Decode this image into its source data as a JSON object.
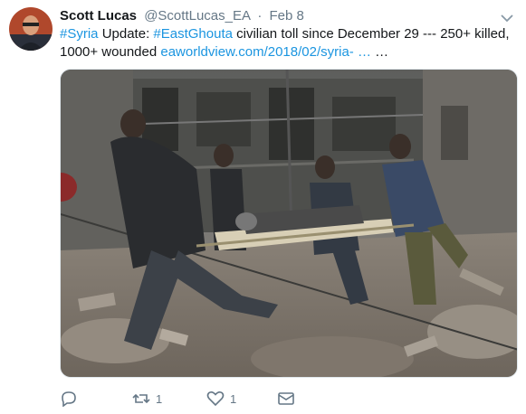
{
  "tweet": {
    "author_name": "Scott Lucas",
    "handle": "@ScottLucas_EA",
    "separator": "·",
    "date": "Feb 8",
    "text": {
      "hashtag1": "#Syria",
      "part1": " Update: ",
      "hashtag2": "#EastGhouta",
      "part2": " civilian toll since December 29 --- 250+ killed, 1000+ wounded ",
      "link": "eaworldview.com/2018/02/syria- …",
      "ellipsis": " …"
    },
    "photo_icon": "photo-stretcher-rubble"
  },
  "actions": {
    "reply_icon": "reply-icon",
    "retweet_count": "1",
    "like_count": "1",
    "dm_icon": "envelope-icon"
  },
  "colors": {
    "link": "#1b95e0",
    "muted": "#657786",
    "text": "#14171a"
  }
}
